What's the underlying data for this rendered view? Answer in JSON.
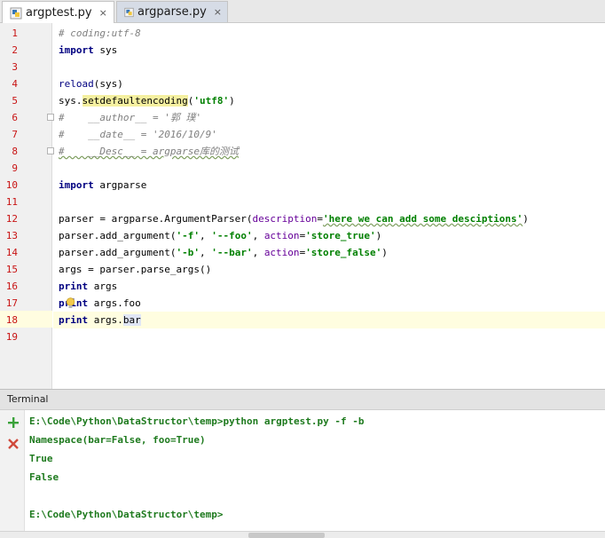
{
  "tabs": [
    {
      "label": "argptest.py",
      "close": "×",
      "active": true
    },
    {
      "label": "argparse.py",
      "close": "×",
      "active": false
    }
  ],
  "editor": {
    "current_line": 18,
    "line_numbers": [
      "1",
      "2",
      "3",
      "4",
      "5",
      "6",
      "7",
      "8",
      "9",
      "10",
      "11",
      "12",
      "13",
      "14",
      "15",
      "16",
      "17",
      "18",
      "19"
    ],
    "code": {
      "l1": "# coding:utf-8",
      "l2_kw": "import",
      "l2_rest": " sys",
      "l4_fn": "reload",
      "l4_rest": "(sys)",
      "l5_a": "sys.",
      "l5_fn": "setdefaultencoding",
      "l5_b": "(",
      "l5_str": "'utf8'",
      "l5_c": ")",
      "l6": "#    __author__ = '郭 璞'",
      "l7": "#    __date__ = '2016/10/9'",
      "l8": "#    __Desc__ = argparse库的测试",
      "l10_kw": "import",
      "l10_rest": " argparse",
      "l12_a": "parser = argparse.ArgumentParser(",
      "l12_param": "description",
      "l12_b": "=",
      "l12_str": "'here we can add some desciptions'",
      "l12_c": ")",
      "l13_a": "parser.add_argument(",
      "l13_s1": "'-f'",
      "l13_b": ", ",
      "l13_s2": "'--foo'",
      "l13_c": ", ",
      "l13_param": "action",
      "l13_d": "=",
      "l13_s3": "'store_true'",
      "l13_e": ")",
      "l14_a": "parser.add_argument(",
      "l14_s1": "'-b'",
      "l14_b": ", ",
      "l14_s2": "'--bar'",
      "l14_c": ", ",
      "l14_param": "action",
      "l14_d": "=",
      "l14_s3": "'store_false'",
      "l14_e": ")",
      "l15": "args = parser.parse_args()",
      "l16_kw": "print",
      "l16_rest": " args",
      "l17_kw": "print",
      "l17_rest": " args.foo",
      "l18_kw": "print",
      "l18_a": " args.",
      "l18_b": "bar"
    }
  },
  "terminal": {
    "title": "Terminal",
    "add_icon": "plus-icon",
    "close_icon": "close-icon",
    "lines": [
      "E:\\Code\\Python\\DataStructor\\temp>python argptest.py -f -b",
      "Namespace(bar=False, foo=True)",
      "True",
      "False",
      "",
      "E:\\Code\\Python\\DataStructor\\temp>"
    ]
  },
  "colors": {
    "keyword": "#000080",
    "string": "#008000",
    "comment": "#808080",
    "line_number": "#c81414",
    "terminal_text": "#1e7a1e",
    "current_line_bg": "#fffde0"
  }
}
